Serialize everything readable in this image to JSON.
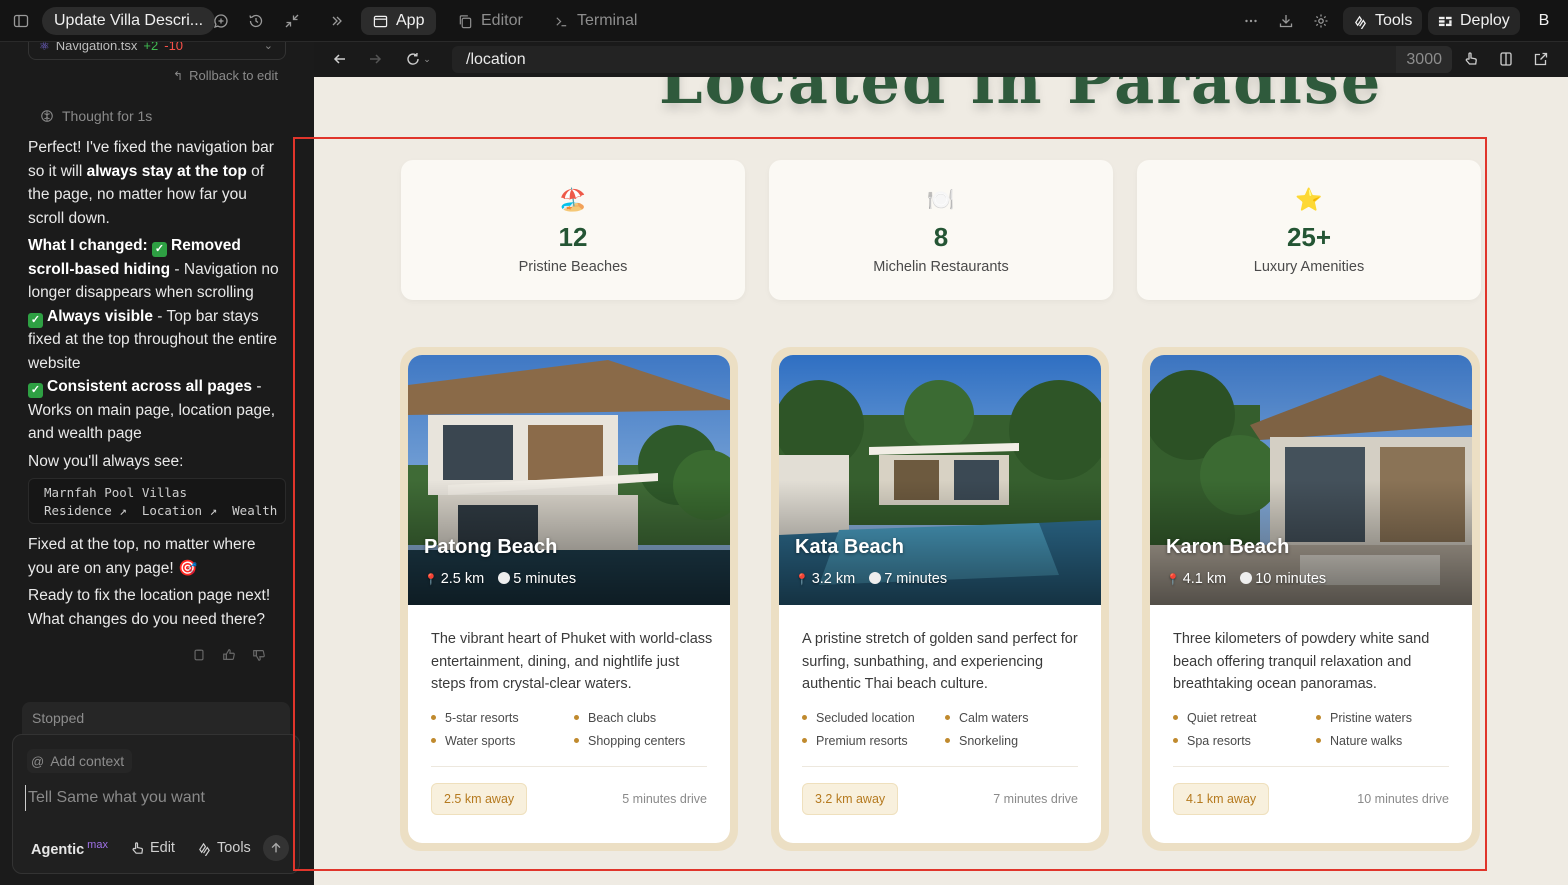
{
  "header": {
    "project_title": "Update Villa Descri...",
    "tabs": [
      {
        "label": "App"
      },
      {
        "label": "Editor"
      },
      {
        "label": "Terminal"
      }
    ],
    "tools_label": "Tools",
    "deploy_label": "Deploy",
    "avatar_initial": "B"
  },
  "chat": {
    "file": {
      "name": "Navigation.tsx",
      "added": "+2",
      "removed": "-10"
    },
    "rollback_label": "Rollback to edit",
    "thought_label": "Thought for 1s",
    "intro_pre": "Perfect! I've fixed the navigation bar so it will ",
    "intro_bold": "always stay at the top",
    "intro_post": " of the page, no matter how far you scroll down.",
    "changed_heading": "What I changed:",
    "change1_bold": "Removed scroll-based hiding",
    "change1_text": " - Navigation no longer disappears when scrolling",
    "change2_bold": "Always visible",
    "change2_text": " - Top bar stays fixed at the top throughout the entire website",
    "change3_bold": "Consistent across all pages",
    "change3_text": " - Works on main page, location page, and wealth page",
    "see_label": "Now you'll always see:",
    "code_line1": "Marnfah Pool Villas",
    "code_line2": "Residence ↗  Location ↗  Wealth",
    "fixed_text": "Fixed at the top, no matter where you are on any page! 🎯",
    "ready_text": "Ready to fix the location page next! What changes do you need there?",
    "stopped_label": "Stopped",
    "add_context_label": "Add context",
    "input_placeholder": "Tell Same what you want",
    "mode_label": "Agentic",
    "mode_tier": "max",
    "edit_label": "Edit",
    "tools_label": "Tools"
  },
  "browser": {
    "url": "/location",
    "port": "3000"
  },
  "preview": {
    "hero_partial": "Located in Paradise",
    "stats": [
      {
        "emoji": "🏖️",
        "value": "12",
        "label": "Pristine Beaches"
      },
      {
        "emoji": "🍽️",
        "value": "8",
        "label": "Michelin Restaurants"
      },
      {
        "emoji": "⭐",
        "value": "25+",
        "label": "Luxury Amenities"
      }
    ],
    "beaches": [
      {
        "name": "Patong Beach",
        "distance": "2.5 km",
        "time": "5 minutes",
        "description": "The vibrant heart of Phuket with world-class entertainment, dining, and nightlife just steps from crystal-clear waters.",
        "features": [
          "5-star resorts",
          "Beach clubs",
          "Water sports",
          "Shopping centers"
        ],
        "away": "2.5 km away",
        "drive": "5 minutes drive"
      },
      {
        "name": "Kata Beach",
        "distance": "3.2 km",
        "time": "7 minutes",
        "description": "A pristine stretch of golden sand perfect for surfing, sunbathing, and experiencing authentic Thai beach culture.",
        "features": [
          "Secluded location",
          "Calm waters",
          "Premium resorts",
          "Snorkeling"
        ],
        "away": "3.2 km away",
        "drive": "7 minutes drive"
      },
      {
        "name": "Karon Beach",
        "distance": "4.1 km",
        "time": "10 minutes",
        "description": "Three kilometers of powdery white sand beach offering tranquil relaxation and breathtaking ocean panoramas.",
        "features": [
          "Quiet retreat",
          "Pristine waters",
          "Spa resorts",
          "Nature walks"
        ],
        "away": "4.1 km away",
        "drive": "10 minutes drive"
      }
    ]
  },
  "colors": {
    "accent_green": "#245534",
    "accent_gold": "#c08a2e",
    "highlight_red": "#e0352b"
  }
}
